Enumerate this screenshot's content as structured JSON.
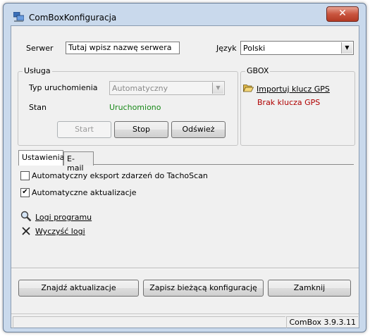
{
  "window": {
    "title": "ComBoxKonfiguracja",
    "close_label": "✕"
  },
  "server": {
    "label": "Serwer",
    "value": "Tutaj wpisz nazwę serwera"
  },
  "language": {
    "label": "Język",
    "value": "Polski"
  },
  "service": {
    "group_label": "Usługa",
    "startup_type_label": "Typ uruchomienia",
    "startup_type_value": "Automatyczny",
    "state_label": "Stan",
    "state_value": "Uruchomiono",
    "state_color": "#1a8a1a",
    "start_label": "Start",
    "stop_label": "Stop",
    "refresh_label": "Odśwież"
  },
  "gbox": {
    "group_label": "GBOX",
    "import_label": "Importuj klucz GPS",
    "missing_key_label": "Brak klucza GPS",
    "missing_key_color": "#b00000",
    "import_icon": "folder-open-icon"
  },
  "tabs": [
    {
      "label": "Ustawienia",
      "active": true
    },
    {
      "label": "E-mail",
      "active": false
    }
  ],
  "settings": {
    "export_label": "Automatyczny eksport zdarzeń do TachoScan",
    "export_checked": false,
    "updates_label": "Automatyczne aktualizacje",
    "updates_checked": true,
    "logs_label": "Logi programu",
    "logs_icon": "magnifier-icon",
    "clear_logs_label": "Wyczyść logi",
    "clear_logs_icon": "x-icon"
  },
  "bottom_buttons": {
    "find_updates": "Znajdź aktualizacje",
    "save_config": "Zapisz bieżącą konfigurację",
    "close": "Zamknij"
  },
  "status": {
    "version": "ComBox 3.9.3.11"
  }
}
